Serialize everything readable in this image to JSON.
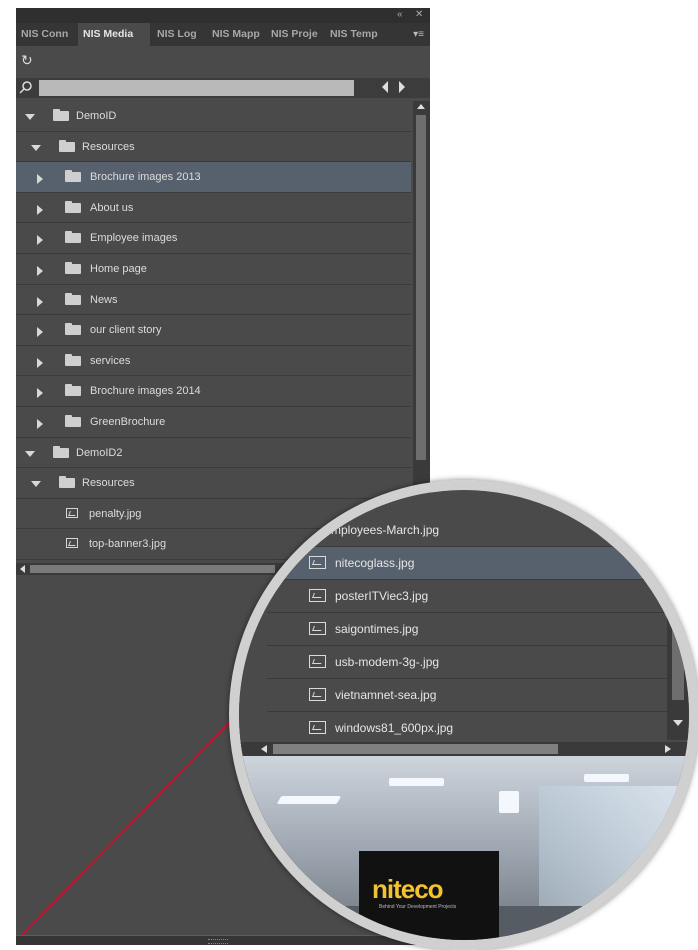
{
  "titlebar": {
    "collapse_glyph": "«",
    "close_glyph": "✕"
  },
  "tabs": [
    {
      "label": "NIS Conn"
    },
    {
      "label": "NIS Media"
    },
    {
      "label": "NIS Log"
    },
    {
      "label": "NIS Mapp"
    },
    {
      "label": "NIS Proje"
    },
    {
      "label": "NIS Temp"
    }
  ],
  "tab_menu_glyph": "▾≡",
  "toolbar": {
    "refresh_icon": "refresh-icon",
    "refresh_glyph": "↻"
  },
  "search": {
    "value": "",
    "icon": "search-icon"
  },
  "tree": [
    {
      "label": "DemoID",
      "type": "folder",
      "expanded": true
    },
    {
      "label": "Resources",
      "type": "folder",
      "expanded": true
    },
    {
      "label": "Brochure images 2013",
      "type": "folder",
      "expanded": false,
      "selected": true
    },
    {
      "label": "About us",
      "type": "folder",
      "expanded": false
    },
    {
      "label": "Employee images",
      "type": "folder",
      "expanded": false
    },
    {
      "label": "Home page",
      "type": "folder",
      "expanded": false
    },
    {
      "label": "News",
      "type": "folder",
      "expanded": false
    },
    {
      "label": "our client story",
      "type": "folder",
      "expanded": false
    },
    {
      "label": "services",
      "type": "folder",
      "expanded": false
    },
    {
      "label": "Brochure images 2014",
      "type": "folder",
      "expanded": false
    },
    {
      "label": "GreenBrochure",
      "type": "folder",
      "expanded": false
    },
    {
      "label": "DemoID2",
      "type": "folder",
      "expanded": true
    },
    {
      "label": "Resources",
      "type": "folder",
      "expanded": true
    },
    {
      "label": "penalty.jpg",
      "type": "file"
    },
    {
      "label": "top-banner3.jpg",
      "type": "file"
    }
  ],
  "magnifier": {
    "files": [
      {
        "label": "-Employees-March.jpg"
      },
      {
        "label": "nitecoglass.jpg",
        "selected": true
      },
      {
        "label": "posterITViec3.jpg"
      },
      {
        "label": "saigontimes.jpg"
      },
      {
        "label": "usb-modem-3g-.jpg"
      },
      {
        "label": "vietnamnet-sea.jpg"
      },
      {
        "label": "windows81_600px.jpg"
      }
    ],
    "preview": {
      "logo_text": "niteco",
      "logo_tagline": "Behind Your Development Projects"
    }
  },
  "colors": {
    "panel_bg": "#4a4a4a",
    "selected_bg": "#57606d",
    "logo": "#f2c230",
    "pointer_line": "#c8102e"
  }
}
